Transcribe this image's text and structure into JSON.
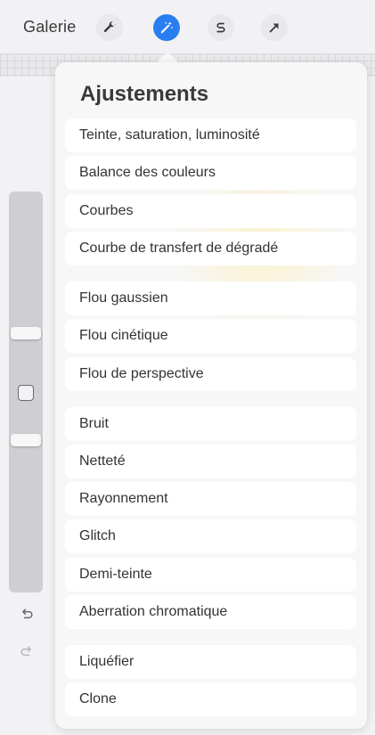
{
  "toolbar": {
    "gallery_label": "Galerie",
    "tools": [
      {
        "name": "wrench-icon",
        "active": false
      },
      {
        "name": "magic-wand-icon",
        "active": true
      },
      {
        "name": "selection-s-icon",
        "active": false
      },
      {
        "name": "move-arrow-icon",
        "active": false
      }
    ],
    "accent_color": "#2a7ff0"
  },
  "adjustments": {
    "title": "Ajustements",
    "groups": [
      [
        "Teinte, saturation, luminosité",
        "Balance des couleurs",
        "Courbes",
        "Courbe de transfert de dégradé"
      ],
      [
        "Flou gaussien",
        "Flou cinétique",
        "Flou de perspective"
      ],
      [
        "Bruit",
        "Netteté",
        "Rayonnement",
        "Glitch",
        "Demi-teinte",
        "Aberration chromatique"
      ],
      [
        "Liquéfier",
        "Clone"
      ]
    ]
  },
  "sidebar": {
    "icons": [
      "undo-icon",
      "redo-icon"
    ]
  }
}
